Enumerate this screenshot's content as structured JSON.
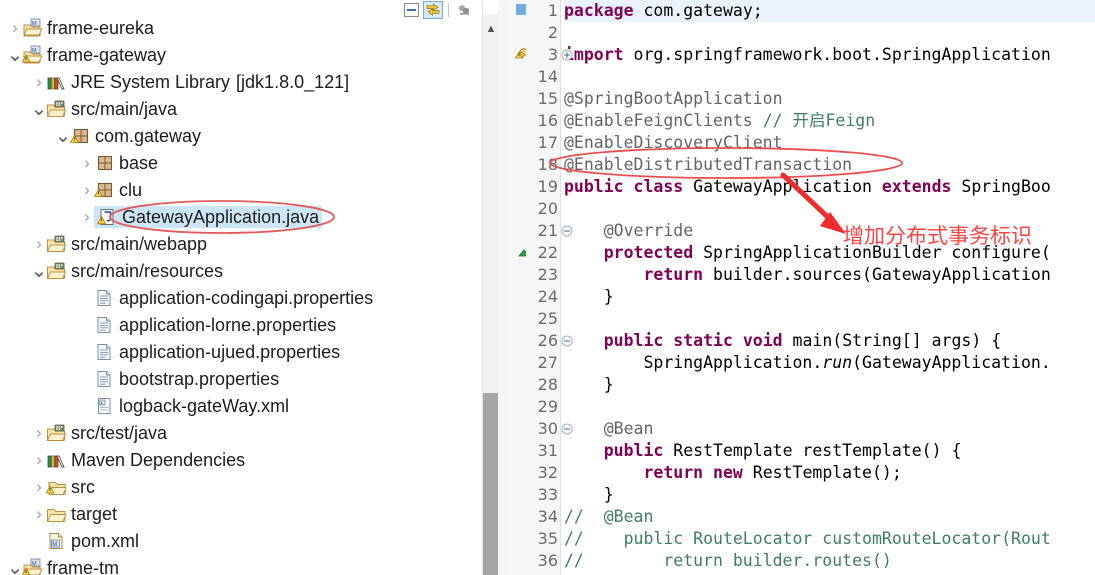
{
  "explorer": {
    "toolbar": [
      {
        "name": "collapse-all-icon",
        "label": "Collapse All",
        "active": false
      },
      {
        "name": "link-with-editor-icon",
        "label": "Link with Editor",
        "active": true
      },
      {
        "name": "view-menu-icon",
        "label": "View Menu",
        "active": false
      }
    ],
    "tree": [
      {
        "label": "frame-eureka",
        "indent": 0,
        "twisty": "collapsed",
        "icon": "maven-project-icon",
        "selected": false
      },
      {
        "label": "frame-gateway",
        "indent": 0,
        "twisty": "expanded",
        "icon": "maven-project-warning-icon",
        "selected": false
      },
      {
        "label": "JRE System Library",
        "suffix": "[jdk1.8.0_121]",
        "indent": 1,
        "twisty": "collapsed",
        "icon": "library-icon",
        "selected": false
      },
      {
        "label": "src/main/java",
        "indent": 1,
        "twisty": "expanded",
        "icon": "source-folder-icon",
        "selected": false
      },
      {
        "label": "com.gateway",
        "indent": 2,
        "twisty": "expanded",
        "icon": "package-warning-icon",
        "selected": false
      },
      {
        "label": "base",
        "indent": 3,
        "twisty": "collapsed",
        "icon": "package-icon",
        "selected": false
      },
      {
        "label": "clu",
        "indent": 3,
        "twisty": "collapsed",
        "icon": "package-warning-icon",
        "selected": false
      },
      {
        "label": "GatewayApplication.java",
        "indent": 3,
        "twisty": "collapsed",
        "icon": "java-file-warning-icon",
        "selected": true
      },
      {
        "label": "src/main/webapp",
        "indent": 1,
        "twisty": "collapsed",
        "icon": "source-folder-icon",
        "selected": false
      },
      {
        "label": "src/main/resources",
        "indent": 1,
        "twisty": "expanded",
        "icon": "source-folder-icon",
        "selected": false
      },
      {
        "label": "application-codingapi.properties",
        "indent": 3,
        "twisty": "none",
        "icon": "properties-file-icon",
        "selected": false
      },
      {
        "label": "application-lorne.properties",
        "indent": 3,
        "twisty": "none",
        "icon": "properties-file-icon",
        "selected": false
      },
      {
        "label": "application-ujued.properties",
        "indent": 3,
        "twisty": "none",
        "icon": "properties-file-icon",
        "selected": false
      },
      {
        "label": "bootstrap.properties",
        "indent": 3,
        "twisty": "none",
        "icon": "properties-file-icon",
        "selected": false
      },
      {
        "label": "logback-gateWay.xml",
        "indent": 3,
        "twisty": "none",
        "icon": "xml-file-icon",
        "selected": false
      },
      {
        "label": "src/test/java",
        "indent": 1,
        "twisty": "collapsed",
        "icon": "source-folder-icon",
        "selected": false
      },
      {
        "label": "Maven Dependencies",
        "indent": 1,
        "twisty": "collapsed",
        "icon": "library-icon",
        "selected": false
      },
      {
        "label": "src",
        "indent": 1,
        "twisty": "collapsed",
        "icon": "folder-warning-icon",
        "selected": false
      },
      {
        "label": "target",
        "indent": 1,
        "twisty": "collapsed",
        "icon": "folder-icon",
        "selected": false
      },
      {
        "label": "pom.xml",
        "indent": 1,
        "twisty": "none",
        "icon": "maven-pom-icon",
        "selected": false
      },
      {
        "label": "frame-tm",
        "indent": 0,
        "twisty": "expanded",
        "icon": "maven-project-warning-icon",
        "selected": false
      }
    ]
  },
  "editor": {
    "lines": [
      {
        "num": "1",
        "fold": "",
        "marker": "search",
        "annotation": "",
        "tokens": [
          {
            "t": "package",
            "c": "kw"
          },
          {
            "t": " com.gateway;",
            "c": "pl"
          }
        ]
      },
      {
        "num": "2",
        "fold": "",
        "marker": "",
        "annotation": "",
        "tokens": []
      },
      {
        "num": "3",
        "fold": "+",
        "marker": "warning",
        "annotation": "",
        "tokens": [
          {
            "t": "import",
            "c": "kw"
          },
          {
            "t": " org.springframework.boot.SpringApplication",
            "c": "pl"
          }
        ]
      },
      {
        "num": "14",
        "fold": "",
        "marker": "",
        "annotation": "",
        "tokens": []
      },
      {
        "num": "15",
        "fold": "",
        "marker": "",
        "annotation": "",
        "tokens": [
          {
            "t": "@SpringBootApplication",
            "c": "an"
          }
        ]
      },
      {
        "num": "16",
        "fold": "",
        "marker": "",
        "annotation": "",
        "tokens": [
          {
            "t": "@EnableFeignClients",
            "c": "an"
          },
          {
            "t": " ",
            "c": "pl"
          },
          {
            "t": "// 开启Feign",
            "c": "cm"
          }
        ]
      },
      {
        "num": "17",
        "fold": "",
        "marker": "",
        "annotation": "",
        "tokens": [
          {
            "t": "@EnableDiscoveryClient",
            "c": "an"
          }
        ]
      },
      {
        "num": "18",
        "fold": "",
        "marker": "",
        "annotation": "",
        "tokens": [
          {
            "t": "@EnableDistributedTransaction",
            "c": "an"
          }
        ]
      },
      {
        "num": "19",
        "fold": "",
        "marker": "",
        "annotation": "",
        "tokens": [
          {
            "t": "public",
            "c": "kw"
          },
          {
            "t": " ",
            "c": "pl"
          },
          {
            "t": "class",
            "c": "kw"
          },
          {
            "t": " GatewayApplication ",
            "c": "pl"
          },
          {
            "t": "extends",
            "c": "kw"
          },
          {
            "t": " SpringBoo",
            "c": "pl"
          }
        ]
      },
      {
        "num": "20",
        "fold": "",
        "marker": "",
        "annotation": "",
        "tokens": []
      },
      {
        "num": "21",
        "fold": "-",
        "marker": "",
        "annotation": "",
        "tokens": [
          {
            "t": "    @Override",
            "c": "an"
          }
        ]
      },
      {
        "num": "22",
        "fold": "",
        "marker": "override",
        "annotation": "",
        "tokens": [
          {
            "t": "    ",
            "c": "pl"
          },
          {
            "t": "protected",
            "c": "kw"
          },
          {
            "t": " SpringApplicationBuilder configure(",
            "c": "pl"
          }
        ]
      },
      {
        "num": "23",
        "fold": "",
        "marker": "",
        "annotation": "",
        "tokens": [
          {
            "t": "        ",
            "c": "pl"
          },
          {
            "t": "return",
            "c": "kw"
          },
          {
            "t": " builder.sources(GatewayApplication",
            "c": "pl"
          }
        ]
      },
      {
        "num": "24",
        "fold": "",
        "marker": "",
        "annotation": "",
        "tokens": [
          {
            "t": "    }",
            "c": "pl"
          }
        ]
      },
      {
        "num": "25",
        "fold": "",
        "marker": "",
        "annotation": "",
        "tokens": []
      },
      {
        "num": "26",
        "fold": "-",
        "marker": "",
        "annotation": "",
        "tokens": [
          {
            "t": "    ",
            "c": "pl"
          },
          {
            "t": "public",
            "c": "kw"
          },
          {
            "t": " ",
            "c": "pl"
          },
          {
            "t": "static",
            "c": "kw"
          },
          {
            "t": " ",
            "c": "pl"
          },
          {
            "t": "void",
            "c": "kw"
          },
          {
            "t": " main(String[] args) {",
            "c": "pl"
          }
        ]
      },
      {
        "num": "27",
        "fold": "",
        "marker": "",
        "annotation": "",
        "tokens": [
          {
            "t": "        SpringApplication.",
            "c": "pl"
          },
          {
            "t": "run",
            "c": "it"
          },
          {
            "t": "(GatewayApplication.",
            "c": "pl"
          }
        ]
      },
      {
        "num": "28",
        "fold": "",
        "marker": "",
        "annotation": "",
        "tokens": [
          {
            "t": "    }",
            "c": "pl"
          }
        ]
      },
      {
        "num": "29",
        "fold": "",
        "marker": "",
        "annotation": "",
        "tokens": []
      },
      {
        "num": "30",
        "fold": "-",
        "marker": "",
        "annotation": "",
        "tokens": [
          {
            "t": "    @Bean",
            "c": "an"
          }
        ]
      },
      {
        "num": "31",
        "fold": "",
        "marker": "",
        "annotation": "",
        "tokens": [
          {
            "t": "    ",
            "c": "pl"
          },
          {
            "t": "public",
            "c": "kw"
          },
          {
            "t": " RestTemplate restTemplate() {",
            "c": "pl"
          }
        ]
      },
      {
        "num": "32",
        "fold": "",
        "marker": "",
        "annotation": "",
        "tokens": [
          {
            "t": "        ",
            "c": "pl"
          },
          {
            "t": "return",
            "c": "kw"
          },
          {
            "t": " ",
            "c": "pl"
          },
          {
            "t": "new",
            "c": "kw"
          },
          {
            "t": " RestTemplate();",
            "c": "pl"
          }
        ]
      },
      {
        "num": "33",
        "fold": "",
        "marker": "",
        "annotation": "",
        "tokens": [
          {
            "t": "    }",
            "c": "pl"
          }
        ]
      },
      {
        "num": "34",
        "fold": "",
        "marker": "",
        "annotation": "",
        "tokens": [
          {
            "t": "//  @Bean",
            "c": "cm"
          }
        ]
      },
      {
        "num": "35",
        "fold": "",
        "marker": "",
        "annotation": "",
        "tokens": [
          {
            "t": "//    public RouteLocator customRouteLocator(Rout",
            "c": "cm"
          }
        ]
      },
      {
        "num": "36",
        "fold": "",
        "marker": "",
        "annotation": "",
        "tokens": [
          {
            "t": "//        return builder.routes()",
            "c": "cm"
          }
        ]
      }
    ]
  },
  "annotations": {
    "note_text": "增加分布式事务标识",
    "note_color": "#ff4444",
    "ellipse_code_target": "@EnableDistributedTransaction",
    "ellipse_tree_target": "GatewayApplication.java"
  }
}
